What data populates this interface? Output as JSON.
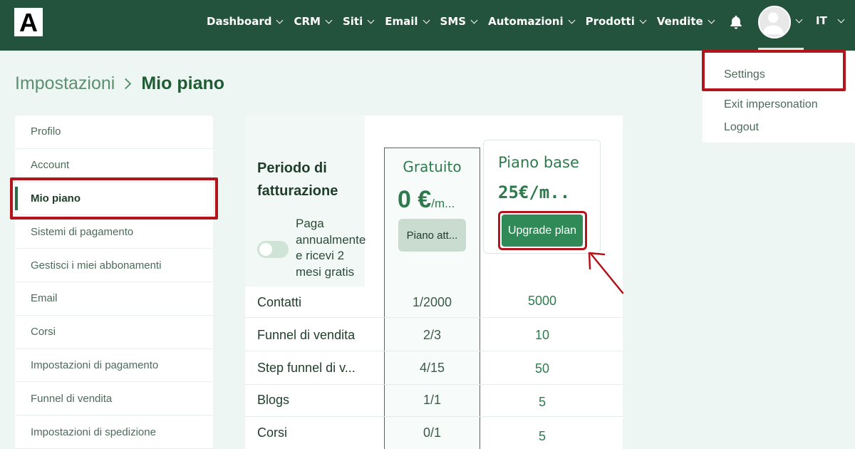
{
  "topbar": {
    "logo_letter": "A",
    "nav": [
      {
        "label": "Dashboard"
      },
      {
        "label": "CRM"
      },
      {
        "label": "Siti"
      },
      {
        "label": "Email"
      },
      {
        "label": "SMS"
      },
      {
        "label": "Automazioni"
      },
      {
        "label": "Prodotti"
      },
      {
        "label": "Vendite"
      }
    ],
    "bell_icon": "bell-icon",
    "avatar_icon": "user-avatar-icon",
    "language": "IT",
    "bg_color": "#23523d"
  },
  "breadcrumb": {
    "parent": "Impostazioni",
    "current": "Mio piano"
  },
  "sidebar": {
    "items": [
      {
        "label": "Profilo"
      },
      {
        "label": "Account"
      },
      {
        "label": "Mio piano"
      },
      {
        "label": "Sistemi di pagamento"
      },
      {
        "label": "Gestisci i miei abbonamenti"
      },
      {
        "label": "Email"
      },
      {
        "label": "Corsi"
      },
      {
        "label": "Impostazioni di pagamento"
      },
      {
        "label": "Funnel di vendita"
      },
      {
        "label": "Impostazioni di spedizione"
      }
    ],
    "active": "Mio piano"
  },
  "billing": {
    "title_line1": "Periodo di",
    "title_line2": "fatturazione",
    "toggle_line1": "Paga",
    "toggle_line2": "annualmente",
    "toggle_line3": "e ricevi 2",
    "toggle_line4": "mesi gratis",
    "toggle_on": false
  },
  "plans": {
    "free": {
      "name": "Gratuito",
      "price": "0 €",
      "period": "/m...",
      "button": "Piano att..."
    },
    "base": {
      "name": "Piano base",
      "price": "25€/m..",
      "button": "Upgrade plan"
    }
  },
  "features": [
    {
      "name": "Contatti",
      "free": "1/2000",
      "base": "5000"
    },
    {
      "name": "Funnel di vendita",
      "free": "2/3",
      "base": "10"
    },
    {
      "name": "Step funnel di v...",
      "free": "4/15",
      "base": "50"
    },
    {
      "name": "Blogs",
      "free": "1/1",
      "base": "5"
    },
    {
      "name": "Corsi",
      "free": "0/1",
      "base": "5"
    }
  ],
  "user_menu": {
    "items": [
      {
        "label": "Settings"
      },
      {
        "label": "Exit impersonation"
      },
      {
        "label": "Logout"
      }
    ]
  },
  "colors": {
    "accent": "#2f7a4d",
    "highlight": "#b2151c"
  }
}
